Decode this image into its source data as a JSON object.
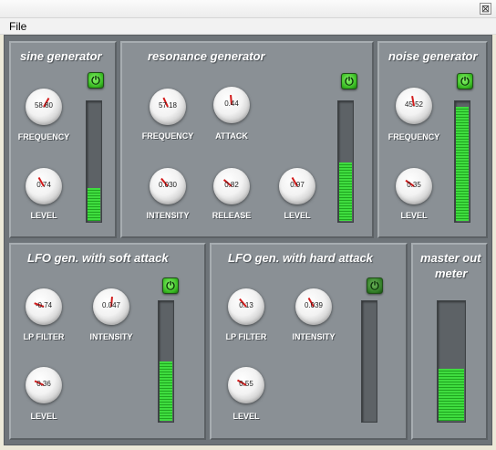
{
  "window": {
    "close_glyph": "⊠"
  },
  "menu": {
    "file": "File"
  },
  "colors": {
    "meter_fill": "#3fdc3f",
    "panel_bg": "#8a9095",
    "knob_needle": "#d21a1a"
  },
  "panels": {
    "sine": {
      "title": "sine generator",
      "power_icon": "power-icon",
      "frequency": {
        "label": "FREQUENCY",
        "value": "58.80"
      },
      "level": {
        "label": "LEVEL",
        "value": "0.74"
      },
      "meter_level": 0.29
    },
    "resonance": {
      "title": "resonance generator",
      "power_icon": "power-icon",
      "frequency": {
        "label": "FREQUENCY",
        "value": "57.18"
      },
      "attack": {
        "label": "ATTACK",
        "value": "0.44"
      },
      "intensity": {
        "label": "INTENSITY",
        "value": "0.030"
      },
      "release": {
        "label": "RELEASE",
        "value": "0.82"
      },
      "level": {
        "label": "LEVEL",
        "value": "0.97"
      },
      "meter_level": 0.5
    },
    "noise": {
      "title": "noise generator",
      "power_icon": "power-icon",
      "frequency": {
        "label": "FREQUENCY",
        "value": "45.52"
      },
      "level": {
        "label": "LEVEL",
        "value": "0.35"
      },
      "meter_level": 0.96
    },
    "lfo_soft": {
      "title": "LFO gen. with soft attack",
      "power_icon": "power-icon",
      "lp_filter": {
        "label": "LP FILTER",
        "value": "-0.74"
      },
      "intensity": {
        "label": "INTENSITY",
        "value": "0.047"
      },
      "level": {
        "label": "LEVEL",
        "value": "0.36"
      },
      "meter_level": 0.51
    },
    "lfo_hard": {
      "title": "LFO gen. with hard attack",
      "power_icon": "power-icon",
      "lp_filter": {
        "label": "LP FILTER",
        "value": "0.13"
      },
      "intensity": {
        "label": "INTENSITY",
        "value": "0.039"
      },
      "level": {
        "label": "LEVEL",
        "value": "0.55"
      },
      "meter_level": 0.0
    },
    "master": {
      "title_line1": "master out",
      "title_line2": "meter",
      "meter_level": 0.45
    }
  }
}
